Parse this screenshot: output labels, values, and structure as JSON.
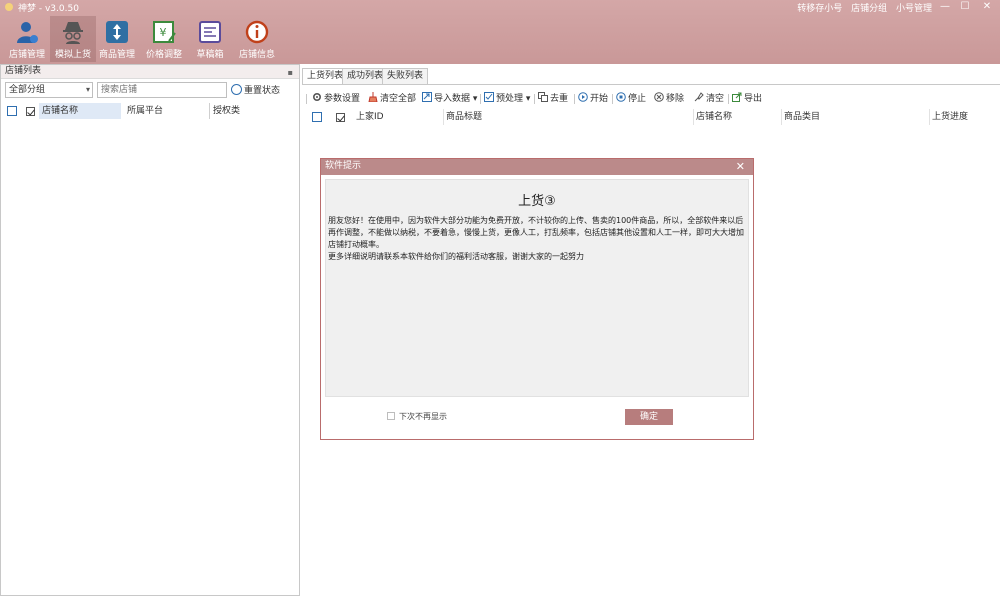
{
  "window": {
    "title": "神梦 - v3.0.50",
    "titlebar_links": [
      "转移存小号",
      "店铺分组",
      "小号管理"
    ],
    "controls": {
      "minimize": "—",
      "maximize": "☐",
      "close": "✕"
    }
  },
  "ribbon": [
    {
      "label": "店铺管理",
      "icon": "user-icon",
      "active": false
    },
    {
      "label": "模拟上货",
      "icon": "spy-icon",
      "active": true
    },
    {
      "label": "商品管理",
      "icon": "transfer-icon",
      "active": false
    },
    {
      "label": "价格调整",
      "icon": "price-tag-icon",
      "active": false
    },
    {
      "label": "草稿箱",
      "icon": "draft-box-icon",
      "active": false
    },
    {
      "label": "店铺信息",
      "icon": "info-icon",
      "active": false
    }
  ],
  "left_panel": {
    "title": "店铺列表",
    "pin": "▪",
    "group_select": "全部分组",
    "search_placeholder": "搜索店铺",
    "reset_label": "重置状态",
    "columns": [
      "店铺名称",
      "所属平台",
      "授权类"
    ]
  },
  "tabs": [
    {
      "label": "上货列表",
      "active": true
    },
    {
      "label": "成功列表",
      "active": false
    },
    {
      "label": "失败列表",
      "active": false
    }
  ],
  "toolbar": [
    {
      "label": "参数设置",
      "icon": "settings-icon"
    },
    {
      "label": "清空全部",
      "icon": "broom-icon"
    },
    {
      "label": "导入数据 ▾",
      "icon": "import-icon"
    },
    {
      "label": "预处理 ▾",
      "icon": "preprocess-icon"
    },
    {
      "label": "去重",
      "icon": "dedupe-icon"
    },
    {
      "label": "开始",
      "icon": "play-icon"
    },
    {
      "label": "停止",
      "icon": "stop-icon"
    },
    {
      "label": "移除",
      "icon": "remove-icon"
    },
    {
      "label": "清空",
      "icon": "clear-icon"
    },
    {
      "label": "导出",
      "icon": "export-icon"
    }
  ],
  "grid_columns": [
    "上家ID",
    "商品标题",
    "店铺名称",
    "商品类目",
    "上货进度"
  ],
  "dialog": {
    "title": "软件提示",
    "close": "✕",
    "heading": "上货③",
    "body": [
      "朋友您好！在使用中，因为软件大部分功能为免费开放，不计较你的上传、售卖的100件商品，所以，全部软件来以后再作调整，不能做以纳税，不要着急，慢慢上货，更像人工，打乱频率，包括店铺其他设置和人工一样，即可大大增加店铺打动概率。",
      "更多详细说明请联系本软件给你们的福利活动客服，谢谢大家的一起努力"
    ],
    "noshow_label": "下次不再显示",
    "ok_label": "确定"
  }
}
